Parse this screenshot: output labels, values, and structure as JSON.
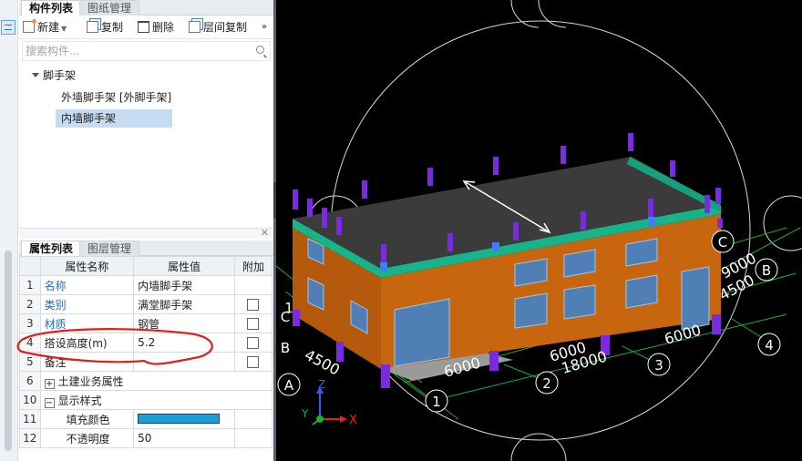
{
  "top_tabs": [
    "构件列表",
    "图纸管理"
  ],
  "toolbar": {
    "new_label": "新建",
    "copy_label": "复制",
    "delete_label": "删除",
    "floor_copy_label": "层间复制",
    "more_label": "»"
  },
  "search": {
    "placeholder": "搜索构件..."
  },
  "tree": {
    "root_label": "脚手架",
    "children": [
      "外墙脚手架 [外脚手架]",
      "内墙脚手架"
    ]
  },
  "prop_tabs": [
    "属性列表",
    "图层管理"
  ],
  "prop_table": {
    "headers": [
      "属性名称",
      "属性值",
      "附加"
    ],
    "rows": [
      {
        "n": "1",
        "name": "名称",
        "value": "内墙脚手架"
      },
      {
        "n": "2",
        "name": "类别",
        "value": "满堂脚手架"
      },
      {
        "n": "3",
        "name": "材质",
        "value": "钢管"
      },
      {
        "n": "4",
        "name": "搭设高度(m)",
        "value": "5.2"
      },
      {
        "n": "5",
        "name": "备注",
        "value": ""
      },
      {
        "n": "6",
        "name": "土建业务属性",
        "value": ""
      },
      {
        "n": "10",
        "name": "显示样式",
        "value": ""
      },
      {
        "n": "11",
        "name": "填充颜色",
        "value": ""
      },
      {
        "n": "12",
        "name": "不透明度",
        "value": "50"
      }
    ]
  },
  "viewport": {
    "dims": [
      "9000",
      "4500",
      "6000",
      "6000",
      "18000",
      "4500",
      "6000"
    ],
    "axis_letters": [
      "A",
      "B",
      "C",
      "B",
      "C",
      "A"
    ],
    "axis_numbers": [
      "1",
      "2",
      "3",
      "4",
      "1"
    ],
    "gizmo": {
      "x": "X",
      "y": "Y",
      "z": "Z"
    }
  },
  "colors": {
    "accent": "#2a6cc6",
    "fill_color": "#1a9fd9",
    "wall": "#c8650f",
    "slab": "#3b3b3b",
    "column": "#7a2be0",
    "beam": "#17b38a",
    "annotation": "#e0201a"
  }
}
